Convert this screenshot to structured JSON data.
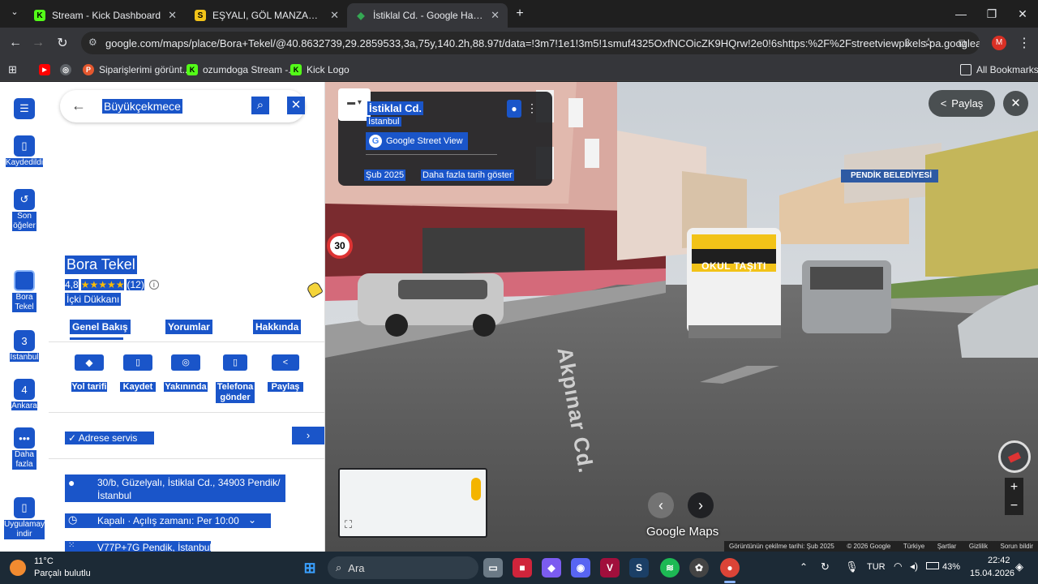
{
  "tabs": [
    {
      "title": "Stream - Kick Dashboard",
      "fav": "K",
      "fav_color": "#53fc18"
    },
    {
      "title": "EŞYALI, GÖL MANZARALI Halka",
      "fav": "S",
      "fav_color": "#f2c318"
    },
    {
      "title": "İstiklal Cd. - Google Haritalar",
      "fav": "◆",
      "fav_color": "#34a853"
    }
  ],
  "address_bar": {
    "url": "google.com/maps/place/Bora+Tekel/@40.8632739,29.2859533,3a,75y,140.2h,88.97t/data=!3m7!1e1!3m5!1smuf4325OxfNCOicZK9HQrw!2e0!6shttps:%2F%2Fstreetviewpixels-pa.googleapi..."
  },
  "bookmarks": [
    {
      "label": "",
      "icon": "youtube-icon",
      "color": "#ff0000"
    },
    {
      "label": "",
      "icon": "globe-icon",
      "color": "#9aa0a6"
    },
    {
      "label": "Siparişlerimi görünt...",
      "icon": "P",
      "color": "#e4572e"
    },
    {
      "label": "ozumdoga Stream -...",
      "icon": "K",
      "color": "#53fc18"
    },
    {
      "label": "Kick Logo",
      "icon": "K",
      "color": "#53fc18"
    }
  ],
  "all_bookmarks": "All Bookmarks",
  "rail": {
    "saved": "Kaydedildi",
    "recent": "Son öğeler",
    "bora": "Bora Tekel",
    "istanbul": "İstanbul",
    "istanbul_num": "3",
    "ankara": "Ankara",
    "ankara_num": "4",
    "more": "Daha fazla",
    "app": "Uygulamayı indir"
  },
  "search": {
    "value": "Büyükçekmece"
  },
  "place": {
    "name": "Bora Tekel",
    "rating": "4,8",
    "stars": "★★★★★",
    "reviews": "(12)",
    "category": "İçki Dükkanı"
  },
  "place_tabs": [
    "Genel Bakış",
    "Yorumlar",
    "Hakkında"
  ],
  "actions": [
    "Yol tarifi",
    "Kaydet",
    "Yakınında",
    "Telefona gönder",
    "Paylaş"
  ],
  "service": "Adrese servis",
  "info": {
    "address": "30/b, Güzelyalı, İstiklal Cd., 34903 Pendik/İstanbul",
    "hours": "Kapalı · Açılış zamanı: Per 10:00",
    "plus_code": "V77P+7G Pendik, İstanbul"
  },
  "streetview": {
    "street": "İstiklal Cd.",
    "city": "İstanbul",
    "brand": "Google Street View",
    "date": "Şub 2025",
    "more_dates": "Daha fazla tarih göster",
    "share": "Paylaş",
    "logo": "Google Maps",
    "sign_pendik": "PENDİK BELEDİYESİ",
    "sign_okul": "OKUL TAŞITI",
    "sign_30": "30",
    "road_text": "Akpınar Cd.",
    "footer": [
      "Görüntünün çekilme tarihi: Şub 2025",
      "© 2026 Google",
      "Türkiye",
      "Şartlar",
      "Gizlilik",
      "Sorun bildir"
    ]
  },
  "taskbar": {
    "weather_temp": "11°C",
    "weather_text": "Parçalı bulutlu",
    "search": "Ara",
    "lang": "TUR",
    "battery": "43%",
    "time": "22:42",
    "date": "15.04.2026"
  }
}
